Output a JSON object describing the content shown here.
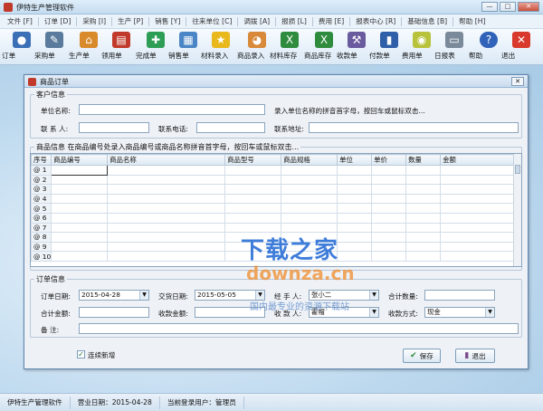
{
  "window": {
    "title": "伊特生产管理软件",
    "controls": [
      "—",
      "□",
      "✕"
    ]
  },
  "menu": [
    "文件 [F]",
    "订单 [D]",
    "采购 [I]",
    "生产 [P]",
    "销售 [Y]",
    "往来单位 [C]",
    "调拨 [A]",
    "报损 [L]",
    "费用 [E]",
    "报表中心 [R]",
    "基础信息 [B]",
    "帮助 [H]"
  ],
  "toolbar": [
    {
      "label": "订单",
      "icon": "people-icon",
      "color": "#3b6fb6",
      "glyph": "👥"
    },
    {
      "label": "采购单",
      "icon": "pen-icon",
      "color": "#5a7b9c",
      "glyph": "✎"
    },
    {
      "label": "生产单",
      "icon": "house-icon",
      "color": "#d98a2b",
      "glyph": "⌂"
    },
    {
      "label": "领用单",
      "icon": "book-icon",
      "color": "#c0392b",
      "glyph": "▤"
    },
    {
      "label": "完成单",
      "icon": "gear-puzzle-icon",
      "color": "#2e9e57",
      "glyph": "✚"
    },
    {
      "label": "销售单",
      "icon": "chart-doc-icon",
      "color": "#4a86c5",
      "glyph": "▦"
    },
    {
      "label": "材料录入",
      "icon": "star-icon",
      "color": "#e8b81c",
      "glyph": "★"
    },
    {
      "label": "商品录入",
      "icon": "palette-icon",
      "color": "#d88a3a",
      "glyph": "◕"
    },
    {
      "label": "材料库存",
      "icon": "excel-icon",
      "color": "#2f8c3e",
      "glyph": "X"
    },
    {
      "label": "商品库存",
      "icon": "excel-icon",
      "color": "#2f8c3e",
      "glyph": "X"
    },
    {
      "label": "收款单",
      "icon": "hammer-icon",
      "color": "#6a5a9e",
      "glyph": "⚒"
    },
    {
      "label": "付款单",
      "icon": "book-blue-icon",
      "color": "#2f5fa8",
      "glyph": "▮"
    },
    {
      "label": "费用单",
      "icon": "coins-icon",
      "color": "#b8c23a",
      "glyph": "◉"
    },
    {
      "label": "日报表",
      "icon": "printer-icon",
      "color": "#7a8a9a",
      "glyph": "▭"
    },
    {
      "label": "帮助",
      "icon": "help-icon",
      "color": "#2f62b8",
      "glyph": "?"
    },
    {
      "label": "退出",
      "icon": "exit-icon",
      "color": "#d9382c",
      "glyph": "✕"
    }
  ],
  "dialog": {
    "title": "商品订单",
    "customer": {
      "legend": "客户信息",
      "unit_name_label": "单位名称:",
      "unit_name_value": "",
      "unit_hint": "录入单位名称的拼音首字母，按回车或鼠标双击...",
      "contact_label": "联 系 人:",
      "phone_label": "联系电话:",
      "address_label": "联系地址:"
    },
    "goods": {
      "legend": "商品信息 在商品编号处录入商品编号或商品名称拼音首字母，按回车或鼠标双击...",
      "columns": [
        "序号",
        "商品编号",
        "商品名称",
        "商品型号",
        "商品规格",
        "单位",
        "单价",
        "数量",
        "金额"
      ],
      "rows": [
        "@ 1",
        "@ 2",
        "@ 3",
        "@ 4",
        "@ 5",
        "@ 6",
        "@ 7",
        "@ 8",
        "@ 9",
        "@ 10"
      ]
    },
    "order": {
      "legend": "订单信息",
      "order_date_label": "订单日期:",
      "order_date_value": "2015-04-28",
      "delivery_date_label": "交货日期:",
      "delivery_date_value": "2015-05-05",
      "handler_label": "经 手 人:",
      "handler_value": "张小二",
      "total_qty_label": "合计数量:",
      "total_amount_label": "合计金额:",
      "received_label": "收款金额:",
      "account_label": "收 款 人:",
      "account_value": "霍帽",
      "pay_method_label": "收款方式:",
      "pay_method_value": "现金",
      "remark_label": "备    注:"
    },
    "continue_label": "连续新增",
    "save_label": "保存",
    "exit_label": "退出"
  },
  "status": {
    "app": "伊特生产管理软件",
    "business_date": "营业日期：",
    "business_date_value": "2015-04-28",
    "user_label": "当前登录用户：",
    "user_value": "管理员"
  },
  "watermark": {
    "line1": "下载之家",
    "line2": "downza.cn",
    "line3": "国内最专业的资源下载站"
  }
}
